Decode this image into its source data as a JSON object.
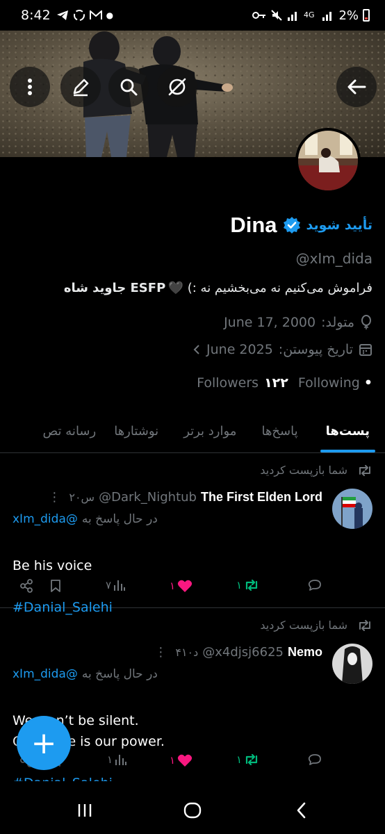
{
  "status_bar": {
    "time": "8:42",
    "battery": "2%",
    "icons": [
      "telegram-icon",
      "recycle-icon",
      "gmail-icon",
      "dot-icon",
      "key-icon",
      "mute-icon",
      "signal-icon",
      "4g-icon",
      "signal-icon"
    ]
  },
  "banner_buttons": [
    "more-icon",
    "edit-icon",
    "search-icon",
    "hide-icon",
    "back-icon"
  ],
  "profile": {
    "verify_label": "تأیید شوید",
    "display_name": "Dina",
    "handle": "@xIm_dida",
    "bio_start": "ESFP  جاوید شاه",
    "bio_heart": "🖤",
    "bio_end": "فراموش می‌کنیم نه می‌بخشیم نه :)",
    "born_label": "متولد:",
    "born_date": "June 17, 2000",
    "joined_label": "تاریخ پیوستن:",
    "joined_date": "June 2025",
    "followers_label": "Followers",
    "followers_count": "۱۲۲",
    "following_label": "Following",
    "following_count": "•"
  },
  "tabs": [
    {
      "label": "پست‌ها",
      "active": true
    },
    {
      "label": "پاسخ‌ها",
      "active": false
    },
    {
      "label": "موارد برتر",
      "active": false
    },
    {
      "label": "نوشتارها",
      "active": false
    },
    {
      "label": "رسانه تص",
      "active": false
    }
  ],
  "posts": [
    {
      "repost_label": "شما بازپست کردید",
      "author": "The First Elden Lord",
      "handle": "@Dark_Nightub",
      "time": "۲۰س",
      "replying_label": "در حال پاسخ به",
      "replying_to": "@xIm_dida",
      "text": "Be his voice",
      "hashtag": "#Danial_Salehi",
      "stats": {
        "views": "۷",
        "likes": "۱",
        "reposts": "۱"
      }
    },
    {
      "repost_label": "شما بازپست کردید",
      "author": "Nemo",
      "handle": "@x4djsj6625",
      "time": "۴۱۰د",
      "replying_label": "در حال پاسخ به",
      "replying_to": "@xIm_dida",
      "text": "We won’t be silent.\nOur voice is our power.",
      "hashtag": "#Danial_Salehi",
      "stats": {
        "views": "۱",
        "likes": "۱",
        "reposts": "۱"
      }
    }
  ],
  "fab_label": "+",
  "colors": {
    "accent": "#1d9bf0",
    "like": "#f91880",
    "repost": "#00ba7c",
    "muted": "#71767b"
  }
}
